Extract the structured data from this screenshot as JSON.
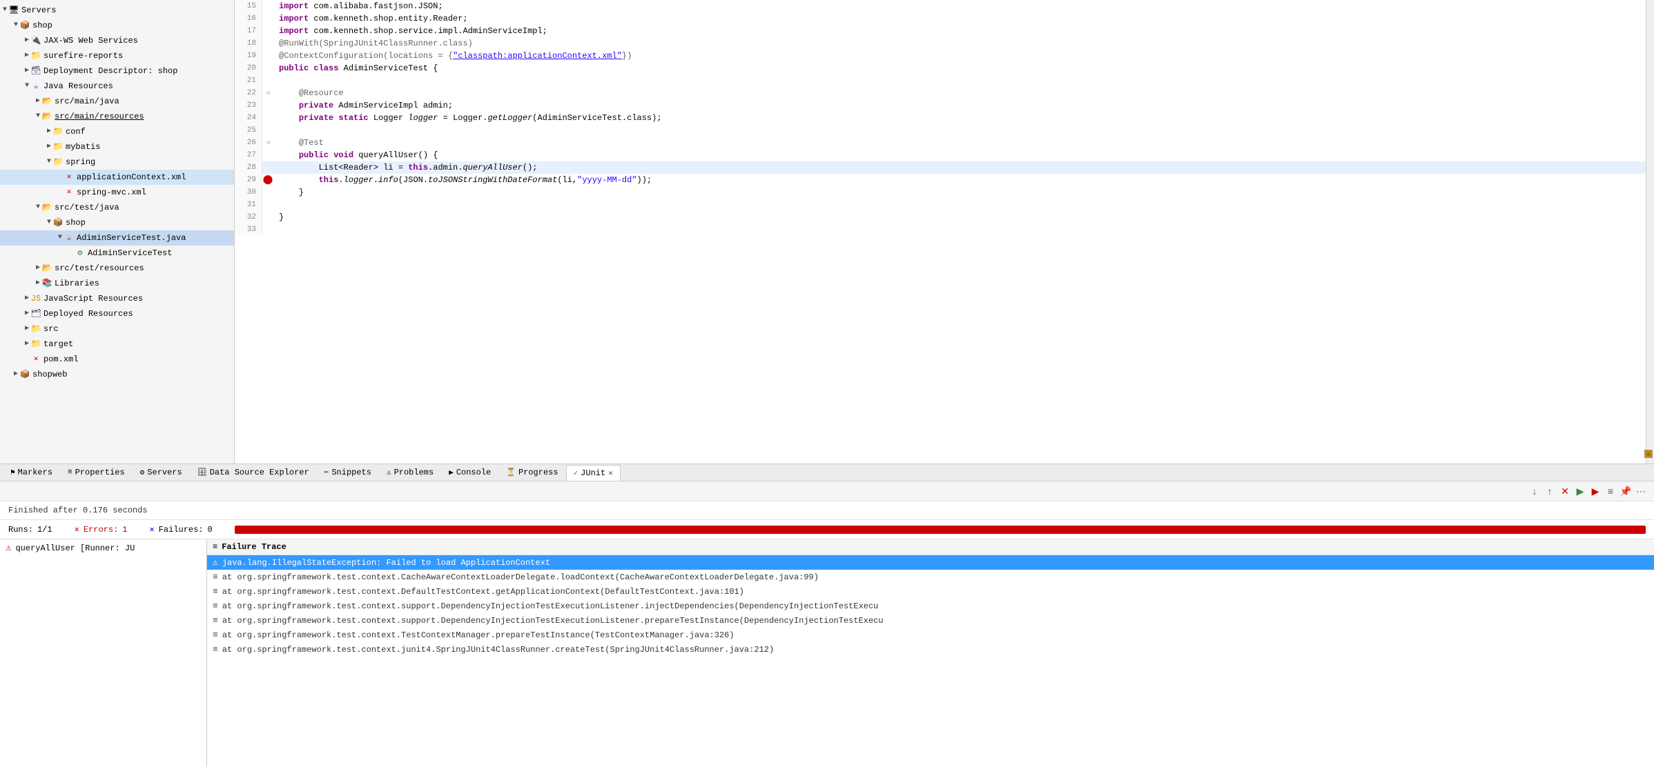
{
  "sidebar": {
    "items": [
      {
        "id": "servers",
        "label": "Servers",
        "level": 0,
        "indent": 0,
        "icon": "server",
        "expanded": true,
        "type": "root"
      },
      {
        "id": "shop",
        "label": "shop",
        "level": 1,
        "indent": 16,
        "icon": "package",
        "expanded": true,
        "type": "project"
      },
      {
        "id": "jax-ws",
        "label": "JAX-WS Web Services",
        "level": 2,
        "indent": 32,
        "icon": "web-service",
        "expanded": false,
        "type": "folder"
      },
      {
        "id": "surefire",
        "label": "surefire-reports",
        "level": 2,
        "indent": 32,
        "icon": "folder",
        "expanded": false,
        "type": "folder"
      },
      {
        "id": "deployment",
        "label": "Deployment Descriptor: shop",
        "level": 2,
        "indent": 32,
        "icon": "deploy",
        "expanded": false,
        "type": "folder"
      },
      {
        "id": "java-resources",
        "label": "Java Resources",
        "level": 2,
        "indent": 32,
        "icon": "java-res",
        "expanded": true,
        "type": "folder"
      },
      {
        "id": "src-main-java",
        "label": "src/main/java",
        "level": 3,
        "indent": 48,
        "icon": "src-folder",
        "expanded": false,
        "type": "folder"
      },
      {
        "id": "src-main-resources",
        "label": "src/main/resources",
        "level": 3,
        "indent": 48,
        "icon": "src-folder",
        "expanded": true,
        "type": "folder",
        "underline": true
      },
      {
        "id": "conf",
        "label": "conf",
        "level": 4,
        "indent": 64,
        "icon": "folder",
        "expanded": false,
        "type": "folder"
      },
      {
        "id": "mybatis",
        "label": "mybatis",
        "level": 4,
        "indent": 64,
        "icon": "folder",
        "expanded": false,
        "type": "folder"
      },
      {
        "id": "spring",
        "label": "spring",
        "level": 4,
        "indent": 64,
        "icon": "folder",
        "expanded": true,
        "type": "folder"
      },
      {
        "id": "applicationContext",
        "label": "applicationContext.xml",
        "level": 5,
        "indent": 80,
        "icon": "xml",
        "expanded": false,
        "type": "file",
        "selected": true
      },
      {
        "id": "spring-mvc",
        "label": "spring-mvc.xml",
        "level": 5,
        "indent": 80,
        "icon": "xml",
        "expanded": false,
        "type": "file"
      },
      {
        "id": "src-test-java",
        "label": "src/test/java",
        "level": 3,
        "indent": 48,
        "icon": "src-folder",
        "expanded": true,
        "type": "folder"
      },
      {
        "id": "shop-test",
        "label": "shop",
        "level": 4,
        "indent": 64,
        "icon": "package",
        "expanded": true,
        "type": "folder"
      },
      {
        "id": "AdiminServiceTest-java",
        "label": "AdiminServiceTest.java",
        "level": 5,
        "indent": 80,
        "icon": "java-test",
        "expanded": true,
        "type": "file",
        "highlighted": true
      },
      {
        "id": "AdiminServiceTest-class",
        "label": "AdiminServiceTest",
        "level": 6,
        "indent": 96,
        "icon": "test-class",
        "expanded": false,
        "type": "class"
      },
      {
        "id": "src-test-resources",
        "label": "src/test/resources",
        "level": 3,
        "indent": 48,
        "icon": "src-folder",
        "expanded": false,
        "type": "folder"
      },
      {
        "id": "libraries",
        "label": "Libraries",
        "level": 3,
        "indent": 48,
        "icon": "library",
        "expanded": false,
        "type": "folder"
      },
      {
        "id": "javascript",
        "label": "JavaScript Resources",
        "level": 2,
        "indent": 32,
        "icon": "js",
        "expanded": false,
        "type": "folder"
      },
      {
        "id": "deployed",
        "label": "Deployed Resources",
        "level": 2,
        "indent": 32,
        "icon": "deploy-res",
        "expanded": false,
        "type": "folder"
      },
      {
        "id": "src",
        "label": "src",
        "level": 2,
        "indent": 32,
        "icon": "folder",
        "expanded": false,
        "type": "folder"
      },
      {
        "id": "target",
        "label": "target",
        "level": 2,
        "indent": 32,
        "icon": "folder",
        "expanded": false,
        "type": "folder"
      },
      {
        "id": "pom",
        "label": "pom.xml",
        "level": 2,
        "indent": 32,
        "icon": "xml",
        "expanded": false,
        "type": "file"
      },
      {
        "id": "shopweb",
        "label": "shopweb",
        "level": 1,
        "indent": 16,
        "icon": "package",
        "expanded": false,
        "type": "project"
      }
    ]
  },
  "editor": {
    "lines": [
      {
        "num": 15,
        "content": "import com.alibaba.fastjson.JSON;",
        "arrow": "",
        "type": "normal"
      },
      {
        "num": 16,
        "content": "import com.kenneth.shop.entity.Reader;",
        "arrow": "",
        "type": "normal"
      },
      {
        "num": 17,
        "content": "import com.kenneth.shop.service.impl.AdminServiceImpl;",
        "arrow": "",
        "type": "normal"
      },
      {
        "num": 18,
        "content": "@RunWith(SpringJUnit4ClassRunner.class)",
        "arrow": "",
        "type": "annotation"
      },
      {
        "num": 19,
        "content": "@ContextConfiguration(locations = {\"classpath:applicationContext.xml\"})",
        "arrow": "",
        "type": "annotation-underline"
      },
      {
        "num": 20,
        "content": "public class AdiminServiceTest {",
        "arrow": "",
        "type": "normal"
      },
      {
        "num": 21,
        "content": "",
        "arrow": "",
        "type": "blank"
      },
      {
        "num": 22,
        "content": "    @Resource",
        "arrow": "◁",
        "type": "annotation"
      },
      {
        "num": 23,
        "content": "    private AdminServiceImpl admin;",
        "arrow": "",
        "type": "normal"
      },
      {
        "num": 24,
        "content": "    private static Logger logger = Logger.getLogger(AdiminServiceTest.class);",
        "arrow": "",
        "type": "normal"
      },
      {
        "num": 25,
        "content": "",
        "arrow": "",
        "type": "blank"
      },
      {
        "num": 26,
        "content": "    @Test",
        "arrow": "◁",
        "type": "annotation"
      },
      {
        "num": 27,
        "content": "    public void queryAllUser() {",
        "arrow": "",
        "type": "normal"
      },
      {
        "num": 28,
        "content": "        List<Reader> li = this.admin.queryAllUser();",
        "arrow": "",
        "type": "normal",
        "highlighted": true
      },
      {
        "num": 29,
        "content": "        this.logger.info(JSON.toJSONStringWithDateFormat(li,\"yyyy-MM-dd\"));",
        "arrow": "",
        "type": "normal",
        "breakpoint": true
      },
      {
        "num": 30,
        "content": "    }",
        "arrow": "",
        "type": "normal"
      },
      {
        "num": 31,
        "content": "",
        "arrow": "",
        "type": "blank"
      },
      {
        "num": 32,
        "content": "}",
        "arrow": "",
        "type": "normal"
      },
      {
        "num": 33,
        "content": "",
        "arrow": "",
        "type": "blank"
      }
    ]
  },
  "bottom_panel": {
    "tabs": [
      {
        "id": "markers",
        "label": "Markers",
        "active": false
      },
      {
        "id": "properties",
        "label": "Properties",
        "active": false
      },
      {
        "id": "servers",
        "label": "Servers",
        "active": false
      },
      {
        "id": "datasource",
        "label": "Data Source Explorer",
        "active": false
      },
      {
        "id": "snippets",
        "label": "Snippets",
        "active": false
      },
      {
        "id": "problems",
        "label": "Problems",
        "active": false
      },
      {
        "id": "console",
        "label": "Console",
        "active": false
      },
      {
        "id": "progress",
        "label": "Progress",
        "active": false
      },
      {
        "id": "junit",
        "label": "JUnit",
        "active": true
      }
    ],
    "junit": {
      "status": "Finished after 0.176 seconds",
      "runs_label": "Runs:",
      "runs_value": "1/1",
      "errors_label": "Errors:",
      "errors_value": "1",
      "failures_label": "Failures:",
      "failures_value": "0",
      "test_items": [
        {
          "id": "queryAllUser",
          "label": "queryAllUser [Runner: JU",
          "icon": "error"
        }
      ],
      "failure_trace_header": "Failure Trace",
      "trace_items": [
        {
          "id": "t1",
          "text": "java.lang.IllegalStateException: Failed to load ApplicationContext",
          "selected": true,
          "icon": "warning"
        },
        {
          "id": "t2",
          "text": "at org.springframework.test.context.CacheAwareContextLoaderDelegate.loadContext(CacheAwareContextLoaderDelegate.java:99)",
          "selected": false,
          "icon": "stack"
        },
        {
          "id": "t3",
          "text": "at org.springframework.test.context.DefaultTestContext.getApplicationContext(DefaultTestContext.java:101)",
          "selected": false,
          "icon": "stack"
        },
        {
          "id": "t4",
          "text": "at org.springframework.test.context.support.DependencyInjectionTestExecutionListener.injectDependencies(DependencyInjectionTestExecu",
          "selected": false,
          "icon": "stack"
        },
        {
          "id": "t5",
          "text": "at org.springframework.test.context.support.DependencyInjectionTestExecutionListener.prepareTestInstance(DependencyInjectionTestExecu",
          "selected": false,
          "icon": "stack"
        },
        {
          "id": "t6",
          "text": "at org.springframework.test.context.TestContextManager.prepareTestInstance(TestContextManager.java:326)",
          "selected": false,
          "icon": "stack"
        },
        {
          "id": "t7",
          "text": "at org.springframework.test.context.junit4.SpringJUnit4ClassRunner.createTest(SpringJUnit4ClassRunner.java:212)",
          "selected": false,
          "icon": "stack"
        }
      ]
    }
  },
  "toolbar": {
    "nav_prev": "↓",
    "nav_next": "↑",
    "btn_stop": "✕",
    "btn_rerun": "▶",
    "btn_rerun_failed": "▶",
    "btn_history": "≡",
    "btn_pin": "📌",
    "btn_more": "⋯"
  }
}
